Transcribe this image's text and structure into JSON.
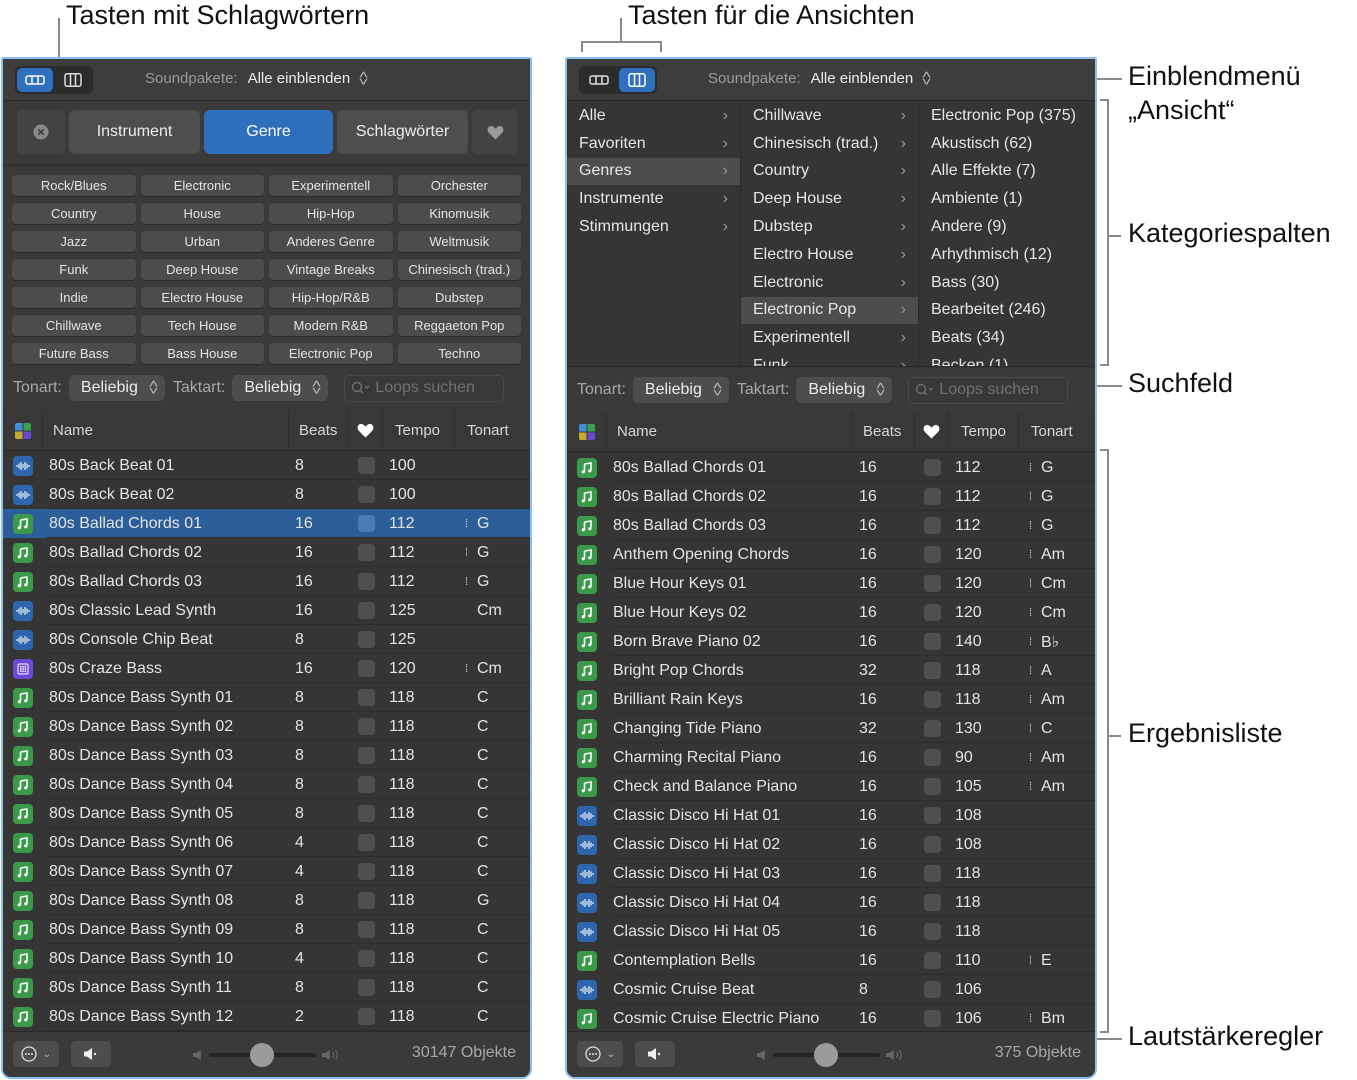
{
  "callouts": {
    "keyword_buttons": "Tasten mit Schlagwörtern",
    "view_buttons": "Tasten für die Ansichten",
    "view_menu_line1": "Einblendmenü",
    "view_menu_line2": "„Ansicht“",
    "category_columns": "Kategoriespalten",
    "search_field": "Suchfeld",
    "result_list": "Ergebnisliste",
    "volume_slider": "Lautstärkeregler"
  },
  "colors": {
    "accent": "#2e6fbd",
    "selection": "#2c5e99",
    "panel_bg": "#353535",
    "midi_icon": "#3a9a4a",
    "audio_icon": "#2e66ad",
    "drummer_icon": "#6b49d6",
    "panel_border": "#8ec0ee"
  },
  "left": {
    "view_mode": "button",
    "soundpacks_label": "Soundpakete:",
    "soundpacks_value": "Alle einblenden",
    "tabs": [
      {
        "label": "Instrument",
        "active": false
      },
      {
        "label": "Genre",
        "active": true
      },
      {
        "label": "Schlagwörter",
        "active": false
      }
    ],
    "keywords": [
      "Rock/Blues",
      "Electronic",
      "Experimentell",
      "Orchester",
      "Country",
      "House",
      "Hip-Hop",
      "Kinomusik",
      "Jazz",
      "Urban",
      "Anderes Genre",
      "Weltmusik",
      "Funk",
      "Deep House",
      "Vintage Breaks",
      "Chinesisch (trad.)",
      "Indie",
      "Electro House",
      "Hip-Hop/R&B",
      "Dubstep",
      "Chillwave",
      "Tech House",
      "Modern R&B",
      "Reggaeton Pop",
      "Future Bass",
      "Bass House",
      "Electronic Pop",
      "Techno"
    ],
    "filters": {
      "key_label": "Tonart:",
      "key_value": "Beliebig",
      "signature_label": "Taktart:",
      "signature_value": "Beliebig",
      "search_placeholder": "Loops suchen"
    },
    "columns": {
      "name": "Name",
      "beats": "Beats",
      "tempo": "Tempo",
      "key": "Tonart"
    },
    "rows": [
      {
        "type": "audio",
        "name": "80s Back Beat 01",
        "beats": "8",
        "tempo": "100",
        "key": "",
        "keymark": false
      },
      {
        "type": "audio",
        "name": "80s Back Beat 02",
        "beats": "8",
        "tempo": "100",
        "key": "",
        "keymark": false
      },
      {
        "type": "midi",
        "name": "80s Ballad Chords 01",
        "beats": "16",
        "tempo": "112",
        "key": "G",
        "keymark": true,
        "selected": true
      },
      {
        "type": "midi",
        "name": "80s Ballad Chords 02",
        "beats": "16",
        "tempo": "112",
        "key": "G",
        "keymark": true
      },
      {
        "type": "midi",
        "name": "80s Ballad Chords 03",
        "beats": "16",
        "tempo": "112",
        "key": "G",
        "keymark": true
      },
      {
        "type": "audio",
        "name": "80s Classic Lead Synth",
        "beats": "16",
        "tempo": "125",
        "key": "Cm",
        "keymark": false
      },
      {
        "type": "audio",
        "name": "80s Console Chip Beat",
        "beats": "8",
        "tempo": "125",
        "key": "",
        "keymark": false
      },
      {
        "type": "drum",
        "name": "80s Craze Bass",
        "beats": "16",
        "tempo": "120",
        "key": "Cm",
        "keymark": true
      },
      {
        "type": "midi",
        "name": "80s Dance Bass Synth 01",
        "beats": "8",
        "tempo": "118",
        "key": "C",
        "keymark": false
      },
      {
        "type": "midi",
        "name": "80s Dance Bass Synth 02",
        "beats": "8",
        "tempo": "118",
        "key": "C",
        "keymark": false
      },
      {
        "type": "midi",
        "name": "80s Dance Bass Synth 03",
        "beats": "8",
        "tempo": "118",
        "key": "C",
        "keymark": false
      },
      {
        "type": "midi",
        "name": "80s Dance Bass Synth 04",
        "beats": "8",
        "tempo": "118",
        "key": "C",
        "keymark": false
      },
      {
        "type": "midi",
        "name": "80s Dance Bass Synth 05",
        "beats": "8",
        "tempo": "118",
        "key": "C",
        "keymark": false
      },
      {
        "type": "midi",
        "name": "80s Dance Bass Synth 06",
        "beats": "4",
        "tempo": "118",
        "key": "C",
        "keymark": false
      },
      {
        "type": "midi",
        "name": "80s Dance Bass Synth 07",
        "beats": "4",
        "tempo": "118",
        "key": "C",
        "keymark": false
      },
      {
        "type": "midi",
        "name": "80s Dance Bass Synth 08",
        "beats": "8",
        "tempo": "118",
        "key": "G",
        "keymark": false
      },
      {
        "type": "midi",
        "name": "80s Dance Bass Synth 09",
        "beats": "8",
        "tempo": "118",
        "key": "C",
        "keymark": false
      },
      {
        "type": "midi",
        "name": "80s Dance Bass Synth 10",
        "beats": "4",
        "tempo": "118",
        "key": "C",
        "keymark": false
      },
      {
        "type": "midi",
        "name": "80s Dance Bass Synth 11",
        "beats": "8",
        "tempo": "118",
        "key": "C",
        "keymark": false
      },
      {
        "type": "midi",
        "name": "80s Dance Bass Synth 12",
        "beats": "2",
        "tempo": "118",
        "key": "C",
        "keymark": false
      }
    ],
    "volume": 0.5,
    "count": "30147 Objekte"
  },
  "right": {
    "view_mode": "column",
    "soundpacks_label": "Soundpakete:",
    "soundpacks_value": "Alle einblenden",
    "browser": {
      "col1": [
        {
          "label": "Alle"
        },
        {
          "label": "Favoriten"
        },
        {
          "label": "Genres",
          "selected": true
        },
        {
          "label": "Instrumente"
        },
        {
          "label": "Stimmungen"
        }
      ],
      "col2": [
        {
          "label": "Chillwave"
        },
        {
          "label": "Chinesisch (trad.)"
        },
        {
          "label": "Country"
        },
        {
          "label": "Deep House"
        },
        {
          "label": "Dubstep"
        },
        {
          "label": "Electro House"
        },
        {
          "label": "Electronic"
        },
        {
          "label": "Electronic Pop",
          "selected": true
        },
        {
          "label": "Experimentell"
        },
        {
          "label": "Funk"
        }
      ],
      "col3": [
        {
          "label": "Electronic Pop (375)"
        },
        {
          "label": "Akustisch (62)"
        },
        {
          "label": "Alle Effekte (7)"
        },
        {
          "label": "Ambiente (1)"
        },
        {
          "label": "Andere (9)"
        },
        {
          "label": "Arhythmisch (12)"
        },
        {
          "label": "Bass (30)"
        },
        {
          "label": "Bearbeitet (246)"
        },
        {
          "label": "Beats (34)"
        },
        {
          "label": "Becken (1)"
        }
      ]
    },
    "filters": {
      "key_label": "Tonart:",
      "key_value": "Beliebig",
      "signature_label": "Taktart:",
      "signature_value": "Beliebig",
      "search_placeholder": "Loops suchen"
    },
    "columns": {
      "name": "Name",
      "beats": "Beats",
      "tempo": "Tempo",
      "key": "Tonart"
    },
    "rows": [
      {
        "type": "midi",
        "name": "80s Ballad Chords 01",
        "beats": "16",
        "tempo": "112",
        "key": "G",
        "keymark": true
      },
      {
        "type": "midi",
        "name": "80s Ballad Chords 02",
        "beats": "16",
        "tempo": "112",
        "key": "G",
        "keymark": true
      },
      {
        "type": "midi",
        "name": "80s Ballad Chords 03",
        "beats": "16",
        "tempo": "112",
        "key": "G",
        "keymark": true
      },
      {
        "type": "midi",
        "name": "Anthem Opening Chords",
        "beats": "16",
        "tempo": "120",
        "key": "Am",
        "keymark": true
      },
      {
        "type": "midi",
        "name": "Blue Hour Keys 01",
        "beats": "16",
        "tempo": "120",
        "key": "Cm",
        "keymark": true
      },
      {
        "type": "midi",
        "name": "Blue Hour Keys 02",
        "beats": "16",
        "tempo": "120",
        "key": "Cm",
        "keymark": true
      },
      {
        "type": "midi",
        "name": "Born Brave Piano 02",
        "beats": "16",
        "tempo": "140",
        "key": "B♭",
        "keymark": true
      },
      {
        "type": "midi",
        "name": "Bright Pop Chords",
        "beats": "32",
        "tempo": "118",
        "key": "A",
        "keymark": true
      },
      {
        "type": "midi",
        "name": "Brilliant Rain Keys",
        "beats": "16",
        "tempo": "118",
        "key": "Am",
        "keymark": true
      },
      {
        "type": "midi",
        "name": "Changing Tide Piano",
        "beats": "32",
        "tempo": "130",
        "key": "C",
        "keymark": true
      },
      {
        "type": "midi",
        "name": "Charming Recital Piano",
        "beats": "16",
        "tempo": "90",
        "key": "Am",
        "keymark": true
      },
      {
        "type": "midi",
        "name": "Check and Balance Piano",
        "beats": "16",
        "tempo": "105",
        "key": "Am",
        "keymark": true
      },
      {
        "type": "audio",
        "name": "Classic Disco Hi Hat 01",
        "beats": "16",
        "tempo": "108",
        "key": "",
        "keymark": false
      },
      {
        "type": "audio",
        "name": "Classic Disco Hi Hat 02",
        "beats": "16",
        "tempo": "108",
        "key": "",
        "keymark": false
      },
      {
        "type": "audio",
        "name": "Classic Disco Hi Hat 03",
        "beats": "16",
        "tempo": "118",
        "key": "",
        "keymark": false
      },
      {
        "type": "audio",
        "name": "Classic Disco Hi Hat 04",
        "beats": "16",
        "tempo": "118",
        "key": "",
        "keymark": false
      },
      {
        "type": "audio",
        "name": "Classic Disco Hi Hat 05",
        "beats": "16",
        "tempo": "118",
        "key": "",
        "keymark": false
      },
      {
        "type": "midi",
        "name": "Contemplation Bells",
        "beats": "16",
        "tempo": "110",
        "key": "E",
        "keymark": true
      },
      {
        "type": "audio",
        "name": "Cosmic Cruise Beat",
        "beats": "8",
        "tempo": "106",
        "key": "",
        "keymark": false
      },
      {
        "type": "midi",
        "name": "Cosmic Cruise Electric Piano",
        "beats": "16",
        "tempo": "106",
        "key": "Bm",
        "keymark": true
      }
    ],
    "volume": 0.5,
    "count": "375 Objekte"
  }
}
